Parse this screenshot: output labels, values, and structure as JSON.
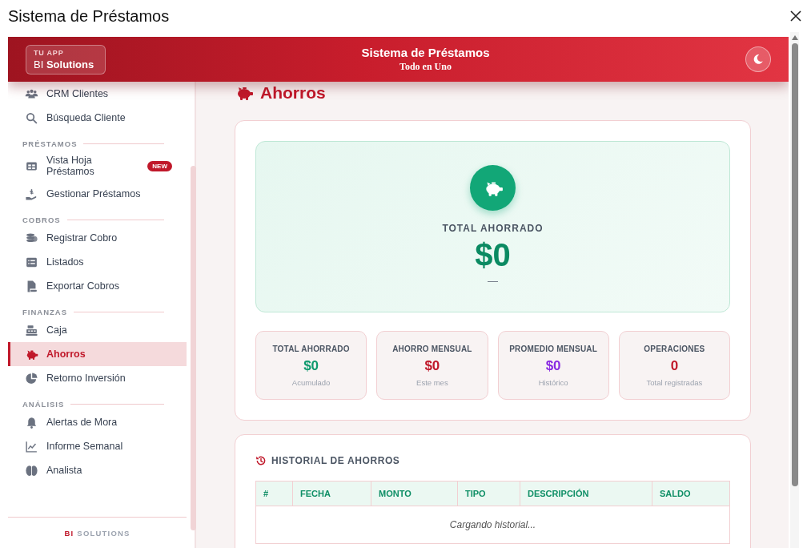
{
  "window": {
    "title": "Sistema de Préstamos"
  },
  "header": {
    "logo_caption": "TU APP",
    "logo_name": "BI **Solutions**",
    "title": "Sistema de Préstamos",
    "subtitle": "Todo en Uno"
  },
  "sidebar": {
    "sections": [
      {
        "items": [
          {
            "label": "CRM Clientes",
            "selected": false
          },
          {
            "label": "Búsqueda Cliente",
            "selected": false
          }
        ]
      },
      {
        "label": "PRÉSTAMOS",
        "items": [
          {
            "label": "Vista Hoja Préstamos",
            "selected": false,
            "badge": "NEW"
          },
          {
            "label": "Gestionar Préstamos",
            "selected": false
          }
        ]
      },
      {
        "label": "COBROS",
        "items": [
          {
            "label": "Registrar Cobro",
            "selected": false
          },
          {
            "label": "Listados",
            "selected": false
          },
          {
            "label": "Exportar Cobros",
            "selected": false
          }
        ]
      },
      {
        "label": "FINANZAS",
        "items": [
          {
            "label": "Caja",
            "selected": false
          },
          {
            "label": "Ahorros",
            "selected": true
          },
          {
            "label": "Retorno Inversión",
            "selected": false
          }
        ]
      },
      {
        "label": "ANÁLISIS",
        "items": [
          {
            "label": "Alertas de Mora",
            "selected": false
          },
          {
            "label": "Informe Semanal",
            "selected": false
          },
          {
            "label": "Analista",
            "selected": false
          }
        ]
      }
    ],
    "footer_accent": "BI",
    "footer_text": "SOLUTIONS"
  },
  "page": {
    "title": "Ahorros"
  },
  "summary": {
    "label": "TOTAL AHORRADO",
    "value": "$0",
    "note": "—"
  },
  "stats": [
    {
      "label": "TOTAL AHORRADO",
      "value": "$0",
      "note": "Acumulado",
      "color": "#0f9a6e"
    },
    {
      "label": "AHORRO MENSUAL",
      "value": "$0",
      "note": "Este mes",
      "color": "#c0182a"
    },
    {
      "label": "PROMEDIO MENSUAL",
      "value": "$0",
      "note": "Histórico",
      "color": "#8a2be2"
    },
    {
      "label": "OPERACIONES",
      "value": "0",
      "note": "Total registradas",
      "color": "#c0182a"
    }
  ],
  "history": {
    "title": "HISTORIAL DE AHORROS",
    "columns": [
      "#",
      "FECHA",
      "MONTO",
      "TIPO",
      "DESCRIPCIÓN",
      "SALDO"
    ],
    "message": "Cargando historial..."
  }
}
